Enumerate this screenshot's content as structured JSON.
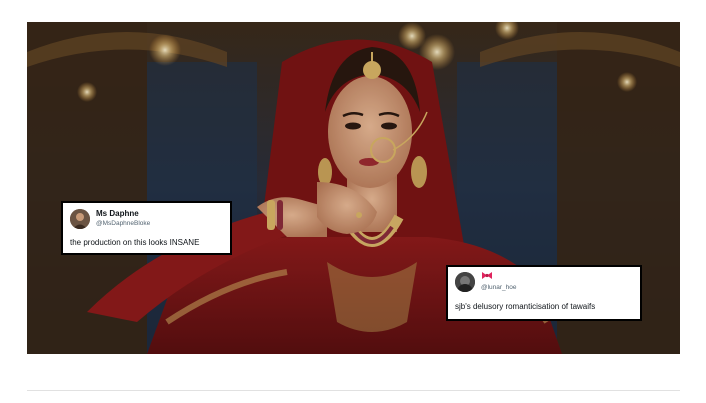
{
  "image": {
    "icon": "photo-scene"
  },
  "tweets": [
    {
      "display_name": "Ms Daphne",
      "handle": "@MsDaphneBloke",
      "text": "the production on this looks INSANE",
      "avatar_icon": "avatar-icon"
    },
    {
      "display_name_icon": "ribbon-bow-icon",
      "handle": "@lunar_hoe",
      "text": "sjb's delusory romanticisation of tawaifs",
      "avatar_icon": "avatar-icon"
    }
  ],
  "colors": {
    "tweet_border": "#000000",
    "tweet_bg": "#ffffff",
    "bow": "#e0245e"
  }
}
